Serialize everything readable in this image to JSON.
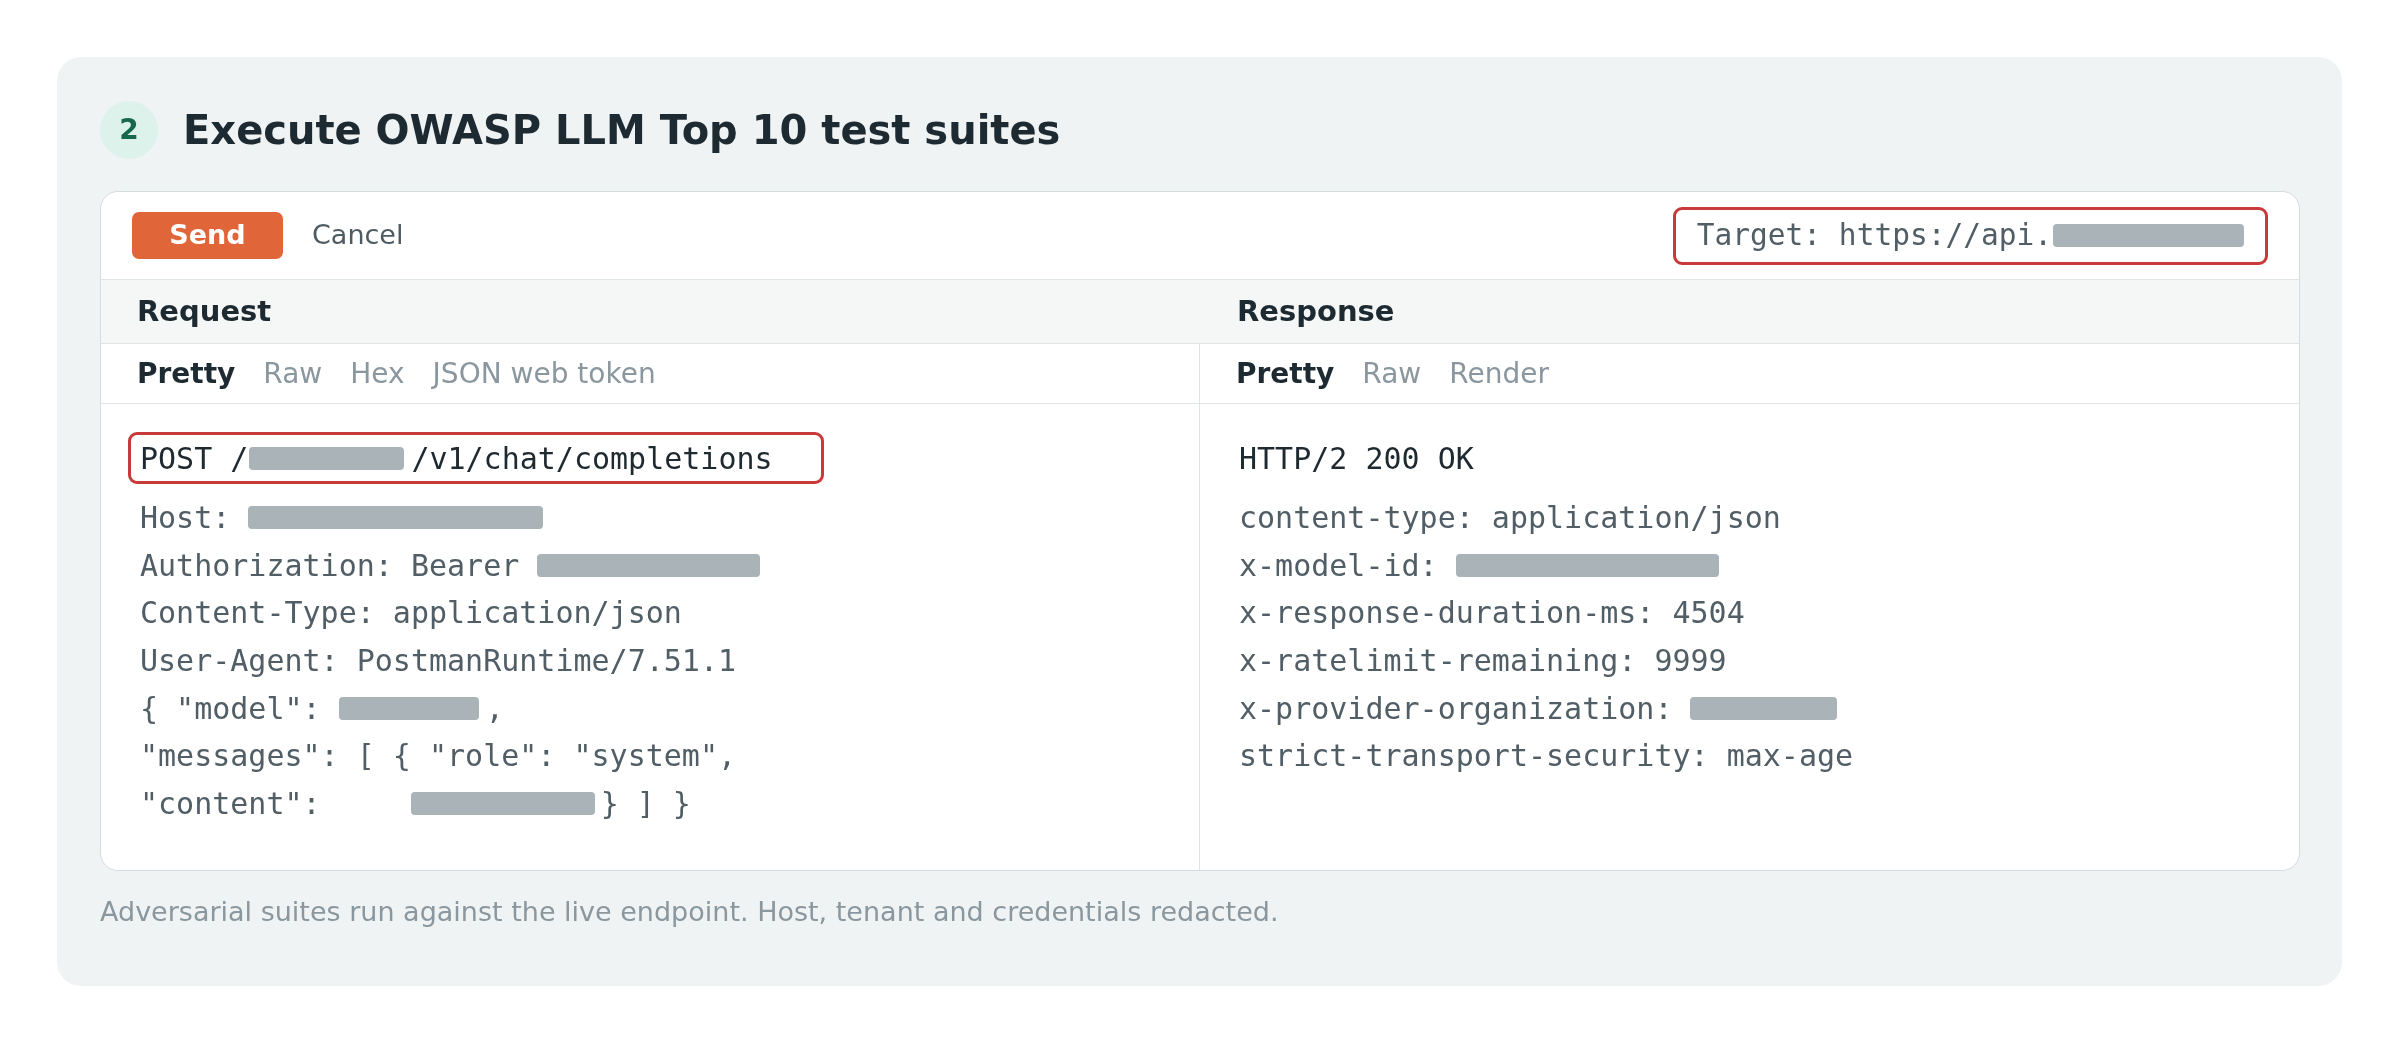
{
  "step": {
    "number": "2",
    "title": "Execute OWASP LLM Top 10 test suites"
  },
  "toolbar": {
    "buttons": [
      {
        "label": "Send",
        "kind": "primary"
      },
      {
        "label": "Cancel",
        "kind": "plain"
      }
    ],
    "target": {
      "highlighted": true,
      "segments": [
        {
          "kind": "text",
          "text": "Target: https://api."
        },
        {
          "kind": "redacted"
        }
      ]
    }
  },
  "panes": [
    {
      "title": "Request",
      "tabs": [
        {
          "label": "Pretty",
          "selected": true
        },
        {
          "label": "Raw",
          "selected": false
        },
        {
          "label": "Hex",
          "selected": false
        },
        {
          "label": "JSON web token",
          "selected": false
        }
      ],
      "lines": [
        {
          "kind": "start_line",
          "highlighted": true,
          "segments": [
            {
              "kind": "text",
              "text": "POST /"
            },
            {
              "kind": "redacted"
            },
            {
              "kind": "text",
              "text": "/v1/chat/completions"
            }
          ]
        },
        {
          "kind": "header",
          "highlighted": false,
          "segments": [
            {
              "kind": "text",
              "text": "Host:"
            },
            {
              "kind": "redacted"
            }
          ]
        },
        {
          "kind": "header",
          "highlighted": false,
          "segments": [
            {
              "kind": "text",
              "text": "Authorization: Bearer"
            },
            {
              "kind": "redacted"
            }
          ]
        },
        {
          "kind": "header",
          "highlighted": false,
          "segments": [
            {
              "kind": "text",
              "text": "Content-Type: application/json"
            }
          ]
        },
        {
          "kind": "header",
          "highlighted": false,
          "segments": [
            {
              "kind": "text",
              "text": "User-Agent: PostmanRuntime/7.51.1"
            }
          ]
        },
        {
          "kind": "body",
          "highlighted": false,
          "segments": [
            {
              "kind": "text",
              "text": "{ \"model\":"
            },
            {
              "kind": "redacted"
            },
            {
              "kind": "text",
              "text": ","
            }
          ]
        },
        {
          "kind": "body",
          "highlighted": false,
          "segments": [
            {
              "kind": "text",
              "text": "\"messages\": [ { \"role\": \"system\","
            }
          ]
        },
        {
          "kind": "body",
          "highlighted": false,
          "segments": [
            {
              "kind": "text",
              "text": "\"content\":"
            },
            {
              "kind": "redacted"
            },
            {
              "kind": "text",
              "text": "} ] }"
            }
          ]
        }
      ]
    },
    {
      "title": "Response",
      "tabs": [
        {
          "label": "Pretty",
          "selected": true
        },
        {
          "label": "Raw",
          "selected": false
        },
        {
          "label": "Render",
          "selected": false
        }
      ],
      "lines": [
        {
          "kind": "start_line",
          "highlighted": false,
          "segments": [
            {
              "kind": "text",
              "text": "HTTP/2 200 OK"
            }
          ]
        },
        {
          "kind": "header",
          "highlighted": false,
          "segments": [
            {
              "kind": "text",
              "text": "content-type: application/json"
            }
          ]
        },
        {
          "kind": "header",
          "highlighted": false,
          "segments": [
            {
              "kind": "text",
              "text": "x-model-id:"
            },
            {
              "kind": "redacted"
            }
          ]
        },
        {
          "kind": "header",
          "highlighted": false,
          "segments": [
            {
              "kind": "text",
              "text": "x-response-duration-ms: 4504"
            }
          ]
        },
        {
          "kind": "header",
          "highlighted": false,
          "segments": [
            {
              "kind": "text",
              "text": "x-ratelimit-remaining: 9999"
            }
          ]
        },
        {
          "kind": "header",
          "highlighted": false,
          "segments": [
            {
              "kind": "text",
              "text": "x-provider-organization:"
            },
            {
              "kind": "redacted"
            }
          ]
        },
        {
          "kind": "header",
          "highlighted": false,
          "segments": [
            {
              "kind": "text",
              "text": "strict-transport-security: max-age"
            }
          ]
        }
      ]
    }
  ],
  "caption": "Adversarial suites run against the live endpoint. Host, tenant and credentials redacted."
}
